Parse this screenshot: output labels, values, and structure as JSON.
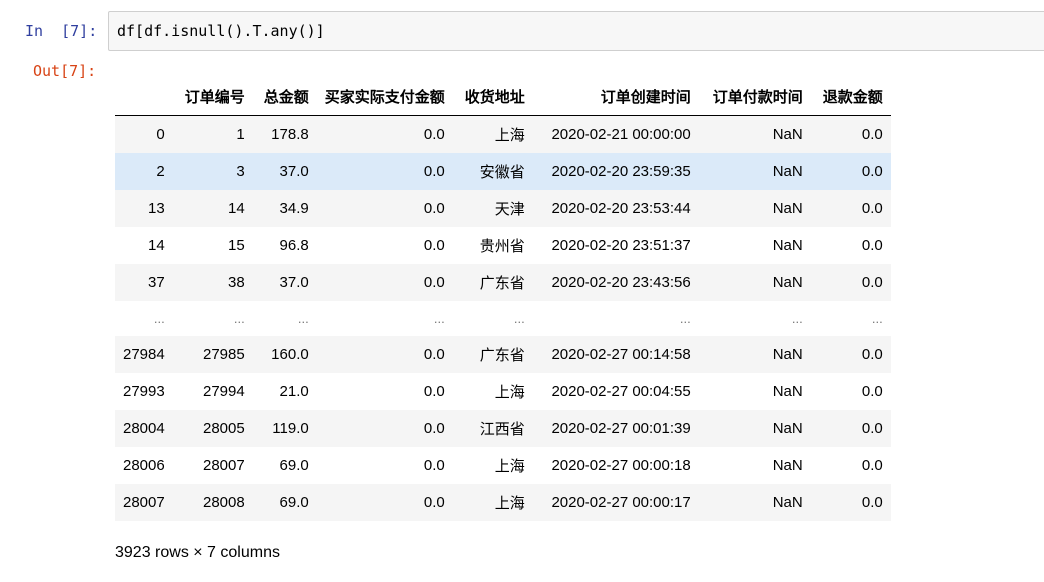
{
  "input_prompt": "In  [7]:",
  "output_prompt": "Out[7]:",
  "code": "df[df.isnull().T.any()]",
  "table": {
    "columns": [
      "",
      "订单编号",
      "总金额",
      "买家实际支付金额",
      "收货地址",
      "订单创建时间",
      "订单付款时间",
      "退款金额"
    ],
    "rows": [
      [
        "0",
        "1",
        "178.8",
        "0.0",
        "上海",
        "2020-02-21 00:00:00",
        "NaN",
        "0.0"
      ],
      [
        "2",
        "3",
        "37.0",
        "0.0",
        "安徽省",
        "2020-02-20 23:59:35",
        "NaN",
        "0.0"
      ],
      [
        "13",
        "14",
        "34.9",
        "0.0",
        "天津",
        "2020-02-20 23:53:44",
        "NaN",
        "0.0"
      ],
      [
        "14",
        "15",
        "96.8",
        "0.0",
        "贵州省",
        "2020-02-20 23:51:37",
        "NaN",
        "0.0"
      ],
      [
        "37",
        "38",
        "37.0",
        "0.0",
        "广东省",
        "2020-02-20 23:43:56",
        "NaN",
        "0.0"
      ],
      [
        "...",
        "...",
        "...",
        "...",
        "...",
        "...",
        "...",
        "..."
      ],
      [
        "27984",
        "27985",
        "160.0",
        "0.0",
        "广东省",
        "2020-02-27 00:14:58",
        "NaN",
        "0.0"
      ],
      [
        "27993",
        "27994",
        "21.0",
        "0.0",
        "上海",
        "2020-02-27 00:04:55",
        "NaN",
        "0.0"
      ],
      [
        "28004",
        "28005",
        "119.0",
        "0.0",
        "江西省",
        "2020-02-27 00:01:39",
        "NaN",
        "0.0"
      ],
      [
        "28006",
        "28007",
        "69.0",
        "0.0",
        "上海",
        "2020-02-27 00:00:18",
        "NaN",
        "0.0"
      ],
      [
        "28007",
        "28008",
        "69.0",
        "0.0",
        "上海",
        "2020-02-27 00:00:17",
        "NaN",
        "0.0"
      ]
    ],
    "highlighted_row_index": 1
  },
  "footer": "3923 rows × 7 columns",
  "colors": {
    "in_prompt": "#303f9f",
    "out_prompt": "#d84315",
    "row_stripe": "#f5f5f5",
    "row_highlight": "#dbeaf9"
  }
}
